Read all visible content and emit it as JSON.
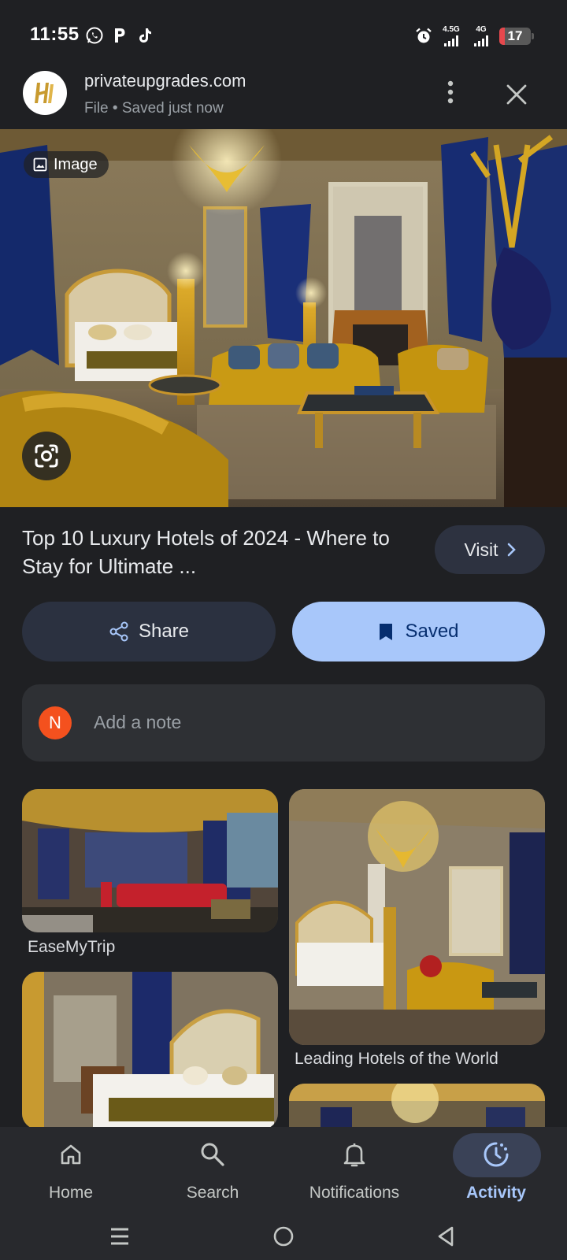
{
  "status_bar": {
    "time": "11:55",
    "left_icons": [
      "whatsapp-icon",
      "parking-icon",
      "tiktok-icon"
    ],
    "alarm_icon": "alarm-icon",
    "network_1": "4.5G",
    "network_2": "4G",
    "battery": "17",
    "battery_fraction": 0.17
  },
  "header": {
    "site": "privateupgrades.com",
    "subtitle": "File • Saved just now"
  },
  "hero": {
    "chip_label": "Image"
  },
  "result": {
    "title": "Top 10 Luxury Hotels of 2024 - Where to Stay for Ultimate ...",
    "visit_label": "Visit"
  },
  "actions": {
    "share_label": "Share",
    "saved_label": "Saved"
  },
  "note": {
    "avatar_initial": "N",
    "placeholder": "Add a note"
  },
  "related": [
    {
      "source": "EaseMyTrip"
    },
    {
      "source": "Leading Hotels of the World"
    }
  ],
  "bottom_nav": {
    "items": [
      {
        "label": "Home",
        "icon": "home-icon"
      },
      {
        "label": "Search",
        "icon": "search-icon"
      },
      {
        "label": "Notifications",
        "icon": "bell-icon"
      },
      {
        "label": "Activity",
        "icon": "activity-icon"
      }
    ],
    "active": "Activity"
  },
  "colors": {
    "background": "#1f2023",
    "accent": "#a8c7fa",
    "avatar": "#f4511e"
  }
}
